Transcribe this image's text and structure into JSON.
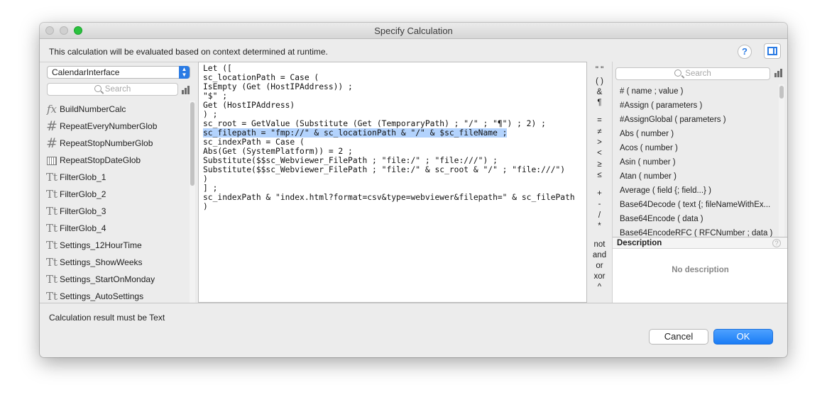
{
  "window": {
    "title": "Specify Calculation",
    "info_text": "This calculation will be evaluated based on context determined at runtime.",
    "help_label": "?"
  },
  "left": {
    "table_select": "CalendarInterface",
    "search_placeholder": "Search",
    "fields": [
      {
        "name": "BuildNumberCalc",
        "icon": "function-icon"
      },
      {
        "name": "RepeatEveryNumberGlob",
        "icon": "number-field-icon"
      },
      {
        "name": "RepeatStopNumberGlob",
        "icon": "number-field-icon"
      },
      {
        "name": "RepeatStopDateGlob",
        "icon": "date-field-icon"
      },
      {
        "name": "FilterGlob_1",
        "icon": "text-field-icon"
      },
      {
        "name": "FilterGlob_2",
        "icon": "text-field-icon"
      },
      {
        "name": "FilterGlob_3",
        "icon": "text-field-icon"
      },
      {
        "name": "FilterGlob_4",
        "icon": "text-field-icon"
      },
      {
        "name": "Settings_12HourTime",
        "icon": "text-field-icon"
      },
      {
        "name": "Settings_ShowWeeks",
        "icon": "text-field-icon"
      },
      {
        "name": "Settings_StartOnMonday",
        "icon": "text-field-icon"
      },
      {
        "name": "Settings_AutoSettings",
        "icon": "text-field-icon"
      }
    ]
  },
  "editor": {
    "lines": [
      "Let ([",
      "sc_locationPath = Case (",
      "IsEmpty (Get (HostIPAddress)) ;",
      "\"$\" ;",
      "Get (HostIPAddress)",
      ") ;",
      "sc_root = GetValue (Substitute (Get (TemporaryPath) ; \"/\" ; \"¶\") ; 2) ;",
      "sc_filepath = \"fmp://\" & sc_locationPath & \"/\" & $sc_fileName ;",
      "sc_indexPath = Case (",
      "Abs(Get (SystemPlatform)) = 2 ;",
      "Substitute($$sc_Webviewer_FilePath ; \"file:/\" ; \"file:///\") ;",
      "Substitute($$sc_Webviewer_FilePath ; \"file:/\" & sc_root & \"/\" ; \"file:///\")",
      ")",
      "] ;",
      "sc_indexPath & \"index.html?format=csv&type=webviewer&filepath=\" & sc_filePath",
      ")"
    ],
    "highlighted_line": 7
  },
  "operators": [
    "\" \"",
    "( )",
    "&",
    "¶",
    "=",
    "≠",
    ">",
    "<",
    "≥",
    "≤",
    "+",
    "-",
    "/",
    "*",
    "not",
    "and",
    "or",
    "xor",
    "^"
  ],
  "functions": {
    "search_placeholder": "Search",
    "items": [
      "# ( name ; value )",
      "#Assign ( parameters )",
      "#AssignGlobal ( parameters )",
      "Abs ( number )",
      "Acos ( number )",
      "Asin ( number )",
      "Atan ( number )",
      "Average ( field {; field...} )",
      "Base64Decode ( text {; fileNameWithEx...",
      "Base64Encode ( data )",
      "Base64EncodeRFC ( RFCNumber ; data )"
    ],
    "description_header": "Description",
    "description_body": "No description"
  },
  "bottom": {
    "result_text": "Calculation result must be  Text",
    "cancel_label": "Cancel",
    "ok_label": "OK"
  },
  "colors": {
    "accent": "#1a7cf5",
    "highlight": "#b3d3fd",
    "maximize": "#2bc23f"
  }
}
